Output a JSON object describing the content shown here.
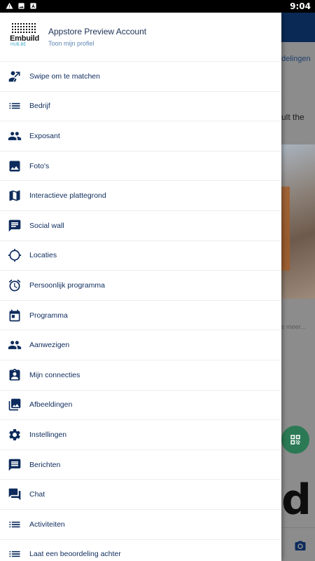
{
  "status_bar": {
    "time": "9:04",
    "icons": [
      "warning-icon",
      "image-icon",
      "app-a-icon"
    ]
  },
  "background_app": {
    "link_fragment": "delingen",
    "text_fragment": "ult the",
    "more_fragment": "s meer..."
  },
  "drawer": {
    "logo": {
      "wordmark": "Embuild",
      "subtext": "HUB.BE"
    },
    "account_name": "Appstore Preview Account",
    "profile_link": "Toon mijn profiel",
    "items": [
      {
        "label": "Swipe om te matchen",
        "icon": "swipe-match-icon"
      },
      {
        "label": "Bedrijf",
        "icon": "list-icon"
      },
      {
        "label": "Exposant",
        "icon": "people-icon"
      },
      {
        "label": "Foto's",
        "icon": "photo-icon"
      },
      {
        "label": "Interactieve plattegrond",
        "icon": "map-icon"
      },
      {
        "label": "Social wall",
        "icon": "chat-bubble-icon"
      },
      {
        "label": "Locaties",
        "icon": "crosshair-icon"
      },
      {
        "label": "Persoonlijk programma",
        "icon": "alarm-icon"
      },
      {
        "label": "Programma",
        "icon": "calendar-icon"
      },
      {
        "label": "Aanwezigen",
        "icon": "people-icon"
      },
      {
        "label": "Mijn connecties",
        "icon": "contact-card-icon"
      },
      {
        "label": "Afbeeldingen",
        "icon": "photo-library-icon"
      },
      {
        "label": "Instellingen",
        "icon": "gear-icon"
      },
      {
        "label": "Berichten",
        "icon": "message-icon"
      },
      {
        "label": "Chat",
        "icon": "forum-icon"
      },
      {
        "label": "Activiteiten",
        "icon": "list-icon"
      },
      {
        "label": "Laat een beoordeling achter",
        "icon": "list-icon"
      }
    ]
  }
}
